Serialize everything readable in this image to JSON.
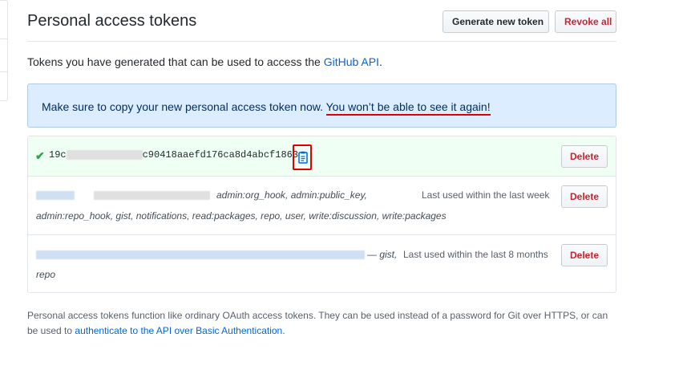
{
  "page": {
    "title": "Personal access tokens",
    "generate_button": "Generate new token",
    "revoke_all_button": "Revoke all"
  },
  "intro": {
    "text": "Tokens you have generated that can be used to access the ",
    "link": "GitHub API",
    "suffix": "."
  },
  "flash": {
    "text": "Make sure to copy your new personal access token now. ",
    "emphasis": "You won’t be able to see it again!"
  },
  "tokens": [
    {
      "prefix": "19c",
      "suffix": "c90418aaefd176ca8d4abcf1863",
      "delete_label": "Delete"
    },
    {
      "scopes_line1": "admin:org_hook, admin:public_key,",
      "scopes_line2": "admin:repo_hook, gist, notifications, read:packages, repo, user, write:discussion, write:packages",
      "last_used": "Last used within the last week",
      "delete_label": "Delete"
    },
    {
      "scopes_line1": "— gist,",
      "scopes_line2": "repo",
      "last_used": "Last used within the last 8 months",
      "delete_label": "Delete"
    }
  ],
  "footer_note": {
    "text": "Personal access tokens function like ordinary OAuth access tokens. They can be used instead of a password for Git over HTTPS, or can be used to ",
    "link": "authenticate to the API over Basic Authentication",
    "suffix": "."
  },
  "colors": {
    "link": "#0366d6",
    "danger": "#cb2431",
    "success": "#28a745",
    "flash_bg": "#dbedff",
    "annotation_red": "#e00000"
  }
}
